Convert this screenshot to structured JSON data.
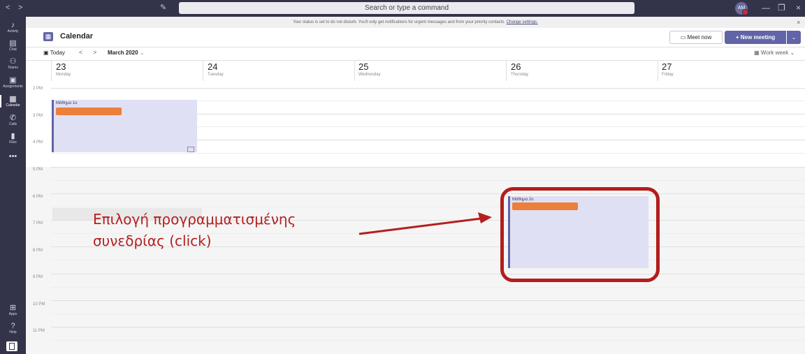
{
  "titlebar": {
    "back": "<",
    "forward": ">",
    "compose_icon": "compose-icon",
    "search_placeholder": "Search or type a command",
    "avatar_initials": "AM",
    "minimize": "—",
    "maximize": "❐",
    "close": "×"
  },
  "rail": {
    "items": [
      {
        "label": "Activity",
        "icon": "bell-icon",
        "glyph": "🔔"
      },
      {
        "label": "Chat",
        "icon": "chat-icon",
        "glyph": "▤"
      },
      {
        "label": "Teams",
        "icon": "teams-icon",
        "glyph": "⚇"
      },
      {
        "label": "Assignments",
        "icon": "assignments-icon",
        "glyph": "▣"
      },
      {
        "label": "Calendar",
        "icon": "calendar-icon",
        "glyph": "▦"
      },
      {
        "label": "Calls",
        "icon": "phone-icon",
        "glyph": "✆"
      },
      {
        "label": "Files",
        "icon": "files-icon",
        "glyph": "▮"
      },
      {
        "label": "",
        "icon": "more-icon",
        "glyph": "•••"
      },
      {
        "label": "Apps",
        "icon": "apps-icon",
        "glyph": "⊞"
      },
      {
        "label": "Help",
        "icon": "help-icon",
        "glyph": "?"
      }
    ]
  },
  "banner": {
    "text": "Your status is set to do not disturb. You'll only get notifications for urgent messages and from your priority contacts.",
    "link": "Change settings."
  },
  "header": {
    "title": "Calendar",
    "meet_now": "Meet now",
    "new_meeting": "+  New meeting"
  },
  "toolbar": {
    "today": "Today",
    "month": "March 2020",
    "view": "Work week"
  },
  "days": [
    {
      "num": "23",
      "name": "Monday"
    },
    {
      "num": "24",
      "name": "Tuesday"
    },
    {
      "num": "25",
      "name": "Wednesday"
    },
    {
      "num": "26",
      "name": "Thursday"
    },
    {
      "num": "27",
      "name": "Friday"
    }
  ],
  "hours": [
    "2 PM",
    "3 PM",
    "4 PM",
    "5 PM",
    "6 PM",
    "7 PM",
    "8 PM",
    "9 PM",
    "10 PM",
    "11 PM"
  ],
  "events": [
    {
      "title": "Μάθημα 1ο",
      "day": "Monday"
    },
    {
      "title": "Μάθημα 2ο",
      "day": "Thursday"
    }
  ],
  "annotation": {
    "line1": "Επιλογή προγραμματισμένης",
    "line2": "συνεδρίας (click)",
    "color": "#b41f1f"
  },
  "colors": {
    "accent": "#6264a7",
    "rail": "#33344a",
    "event_bg": "#e0e0f5",
    "redacted": "#ec7f3a"
  }
}
